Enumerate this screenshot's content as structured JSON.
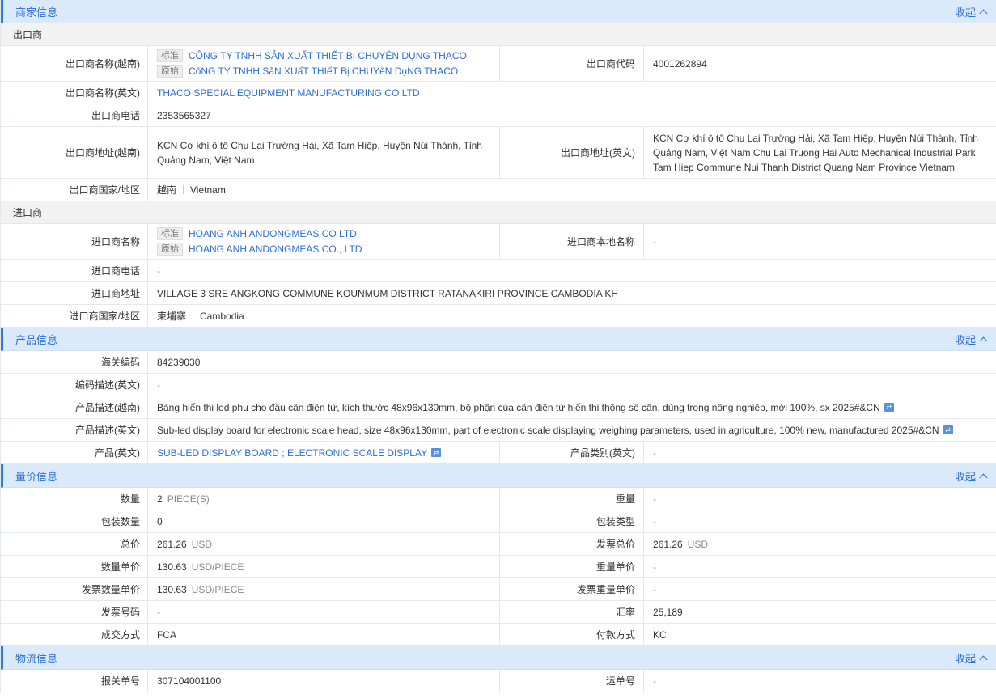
{
  "sections": {
    "merchant": {
      "title": "商家信息",
      "collapse": "收起"
    },
    "product": {
      "title": "产品信息",
      "collapse": "收起"
    },
    "price": {
      "title": "量价信息",
      "collapse": "收起"
    },
    "logistics": {
      "title": "物流信息",
      "collapse": "收起"
    }
  },
  "tags": {
    "std": "标准",
    "orig": "原始"
  },
  "exporter": {
    "sub_title": "出口商",
    "name_vn_label": "出口商名称(越南)",
    "name_vn_std": "CÔNG TY TNHH SẢN XUẤT THIẾT BỊ CHUYÊN DỤNG THACO",
    "name_vn_orig": "CôNG TY TNHH SảN XUấT THIếT Bị CHUYêN DụNG THACO",
    "code_label": "出口商代码",
    "code": "4001262894",
    "name_en_label": "出口商名称(英文)",
    "name_en": "THACO SPECIAL EQUIPMENT MANUFACTURING CO LTD",
    "phone_label": "出口商电话",
    "phone": "2353565327",
    "addr_vn_label": "出口商地址(越南)",
    "addr_vn": "KCN Cơ khí ô tô Chu Lai Trường Hải, Xã Tam Hiệp, Huyện Núi Thành, Tỉnh Quảng Nam, Việt Nam",
    "addr_en_label": "出口商地址(英文)",
    "addr_en": "KCN Cơ khí ô tô Chu Lai Trường Hải, Xã Tam Hiệp, Huyện Núi Thành, Tỉnh Quảng Nam, Việt Nam Chu Lai Truong Hai Auto Mechanical Industrial Park Tam Hiep Commune Nui Thanh District Quang Nam Province Vietnam",
    "country_label": "出口商国家/地区",
    "country_cn": "越南",
    "country_en": "Vietnam"
  },
  "importer": {
    "sub_title": "进口商",
    "name_label": "进口商名称",
    "name_std": "HOANG ANH ANDONGMEAS CO LTD",
    "name_orig": "HOANG ANH ANDONGMEAS CO., LTD",
    "local_name_label": "进口商本地名称",
    "local_name": "-",
    "phone_label": "进口商电话",
    "phone": "-",
    "addr_label": "进口商地址",
    "addr": "VILLAGE 3 SRE ANGKONG COMMUNE KOUNMUM DISTRICT RATANAKIRI PROVINCE CAMBODIA KH",
    "country_label": "进口商国家/地区",
    "country_cn": "柬埔寨",
    "country_en": "Cambodia"
  },
  "product": {
    "hs_label": "海关编码",
    "hs": "84239030",
    "code_desc_label": "编码描述(英文)",
    "code_desc": "-",
    "desc_vn_label": "产品描述(越南)",
    "desc_vn": "Bảng hiển thị led phụ cho đầu cân điện tử, kích thước 48x96x130mm, bộ phận của cân điện tử hiển thị thông số cân, dùng trong nông nghiệp, mới 100%, sx 2025#&CN",
    "desc_en_label": "产品描述(英文)",
    "desc_en": "Sub-led display board for electronic scale head, size 48x96x130mm, part of electronic scale displaying weighing parameters, used in agriculture, 100% new, manufactured 2025#&CN",
    "name_en_label": "产品(英文)",
    "name_en": "SUB-LED DISPLAY BOARD ; ELECTRONIC SCALE DISPLAY",
    "category_label": "产品类别(英文)",
    "category": "-"
  },
  "price": {
    "qty_label": "数量",
    "qty": "2",
    "qty_unit": "PIECE(S)",
    "weight_label": "重量",
    "weight": "-",
    "pkg_qty_label": "包装数量",
    "pkg_qty": "0",
    "pkg_type_label": "包装类型",
    "pkg_type": "-",
    "total_label": "总价",
    "total": "261.26",
    "total_unit": "USD",
    "inv_total_label": "发票总价",
    "inv_total": "261.26",
    "inv_total_unit": "USD",
    "unit_price_label": "数量单价",
    "unit_price": "130.63",
    "unit_price_unit": "USD/PIECE",
    "wt_unit_price_label": "重量单价",
    "wt_unit_price": "-",
    "inv_unit_price_label": "发票数量单价",
    "inv_unit_price": "130.63",
    "inv_unit_price_unit": "USD/PIECE",
    "inv_wt_unit_price_label": "发票重量单价",
    "inv_wt_unit_price": "-",
    "inv_no_label": "发票号码",
    "inv_no": "-",
    "rate_label": "汇率",
    "rate": "25,189",
    "terms_label": "成交方式",
    "terms": "FCA",
    "payment_label": "付款方式",
    "payment": "KC"
  },
  "logistics": {
    "decl_label": "报关单号",
    "decl": "307104001100",
    "waybill_label": "运单号",
    "waybill": "-"
  }
}
